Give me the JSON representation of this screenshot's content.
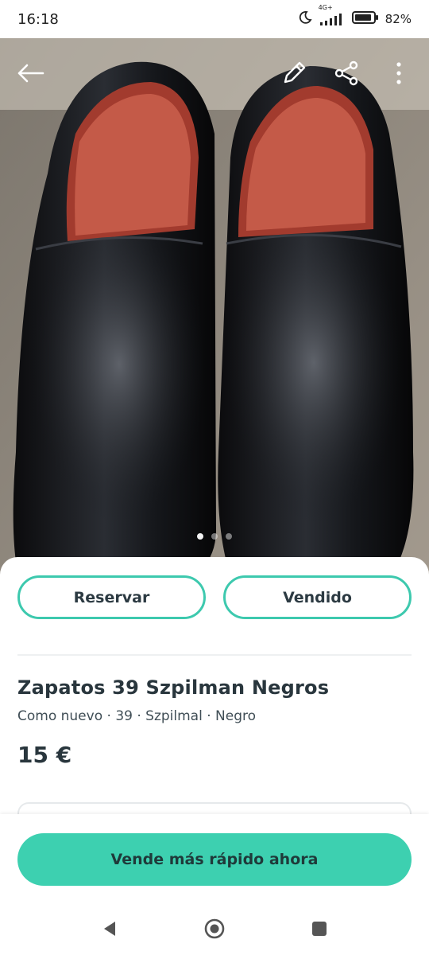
{
  "status_bar": {
    "time": "16:18",
    "network": "4G+",
    "battery": "82%",
    "icons": [
      "moon-icon",
      "signal-icon",
      "battery-icon"
    ]
  },
  "photo_toolbar": {
    "icons": [
      "back-arrow-icon",
      "edit-pencil-icon",
      "share-icon",
      "more-vertical-icon"
    ]
  },
  "carousel": {
    "count": 3,
    "active_index": 0
  },
  "actions": {
    "reserve_label": "Reservar",
    "sold_label": "Vendido"
  },
  "listing": {
    "title": "Zapatos 39 Szpilman Negros",
    "attributes": "Como nuevo · 39 · Szpilmal · Negro",
    "price": "15 €"
  },
  "cta": {
    "label": "Vende más rápido ahora"
  },
  "nav": {
    "icons": [
      "back-triangle-icon",
      "home-circle-icon",
      "recents-square-icon"
    ]
  },
  "colors": {
    "accent": "#3dc9ae",
    "cta_background": "#3dd0b0",
    "text": "#29363d"
  }
}
